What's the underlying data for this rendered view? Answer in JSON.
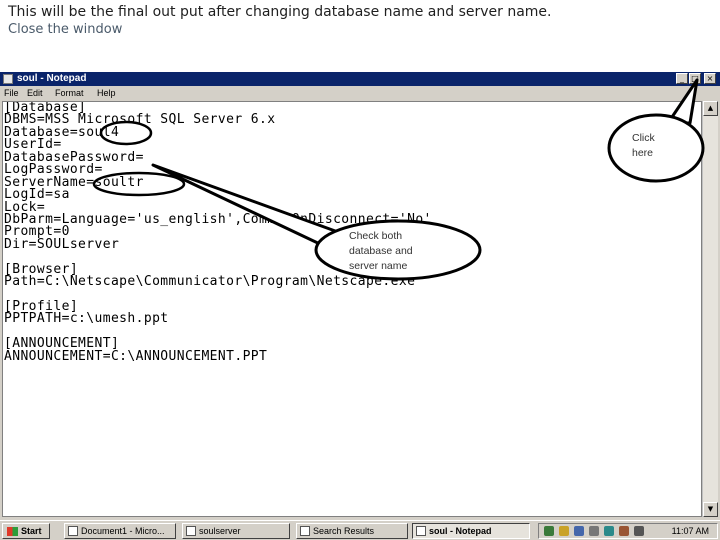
{
  "slide": {
    "title": "This will be the final out put after changing database name and server name.",
    "subtitle": "Close the window"
  },
  "window": {
    "title": "soul - Notepad",
    "controls": {
      "minimize": "_",
      "maximize": "□",
      "close": "×"
    }
  },
  "menu": [
    "File",
    "Edit",
    "Format",
    "Help"
  ],
  "editor_lines": [
    "[Database]",
    "DBMS=MSS Microsoft SQL Server 6.x",
    "Database=soul4",
    "UserId=",
    "DatabasePassword=",
    "LogPassword=",
    "ServerName=soultr",
    "LogId=sa",
    "Lock=",
    "DbParm=Language='us_english',CommitOnDisconnect='No'",
    "Prompt=0",
    "Dir=SOULserver",
    "",
    "[Browser]",
    "Path=C:\\Netscape\\Communicator\\Program\\Netscape.exe",
    "",
    "[Profile]",
    "PPTPATH=c:\\umesh.ppt",
    "",
    "[ANNOUNCEMENT]",
    "ANNOUNCEMENT=C:\\ANNOUNCEMENT.PPT"
  ],
  "callouts": {
    "close": [
      "Click",
      "here"
    ],
    "check": [
      "Check both",
      "database and",
      "server name"
    ]
  },
  "taskbar": {
    "start": "Start",
    "buttons": [
      "Document1 - Micro...",
      "soulserver",
      "Search Results",
      "soul - Notepad"
    ],
    "clock": "11:07 AM"
  },
  "colors": {
    "titlebar": "#0a246a",
    "callout_stroke": "#000000",
    "window_face": "#d4d0c8"
  }
}
